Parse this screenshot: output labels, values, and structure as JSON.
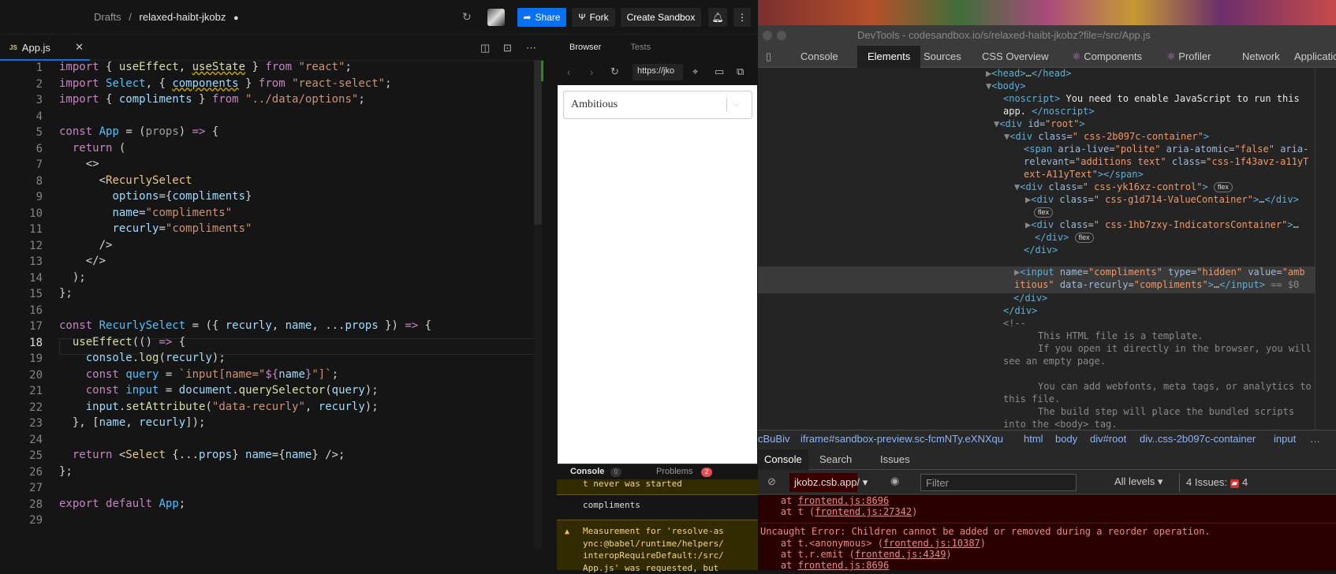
{
  "topbar": {
    "breadcrumb_root": "Drafts",
    "breadcrumb_sep": "/",
    "sandbox_name": "relaxed-haibt-jkobz",
    "share_label": "Share",
    "fork_label": "Fork",
    "create_label": "Create Sandbox"
  },
  "editor": {
    "tab_badge": "JS",
    "tab_label": "App.js",
    "active_line": "18",
    "line_numbers": [
      "1",
      "2",
      "3",
      "4",
      "5",
      "6",
      "7",
      "8",
      "9",
      "10",
      "11",
      "12",
      "13",
      "14",
      "15",
      "16",
      "17",
      "18",
      "19",
      "20",
      "21",
      "22",
      "23",
      "24",
      "25",
      "26",
      "27",
      "28",
      "29"
    ]
  },
  "preview": {
    "tab_browser": "Browser",
    "tab_tests": "Tests",
    "url": "https://jko",
    "select_value": "Ambitious",
    "console_tab": "Console",
    "console_count": "0",
    "problems_tab": "Problems",
    "problems_count": "2",
    "console_lines": {
      "l1": "t never was started",
      "l2": "compliments",
      "l3": "Measurement for 'resolve-as",
      "l4": "ync:@babel/runtime/helpers/",
      "l5": "interopRequireDefault:/src/",
      "l6": "App.js' was requested, but"
    }
  },
  "devtools": {
    "title": "DevTools - codesandbox.io/s/relaxed-haibt-jkobz?file=/src/App.js",
    "tabs": [
      "Console",
      "Elements",
      "Sources",
      "CSS Overview",
      "Components",
      "Profiler",
      "Network",
      "Applicatio"
    ],
    "breadcrumb": [
      "cBuBiv",
      "iframe#sandbox-preview.sc-fcmNTy.eXNXqu",
      "html",
      "body",
      "div#root",
      "div..css-2b097c-container",
      "input"
    ],
    "console_tabs": [
      "Console",
      "Search",
      "Issues"
    ],
    "context": "jkobz.csb.app/",
    "filter_placeholder": "Filter",
    "levels": "All levels",
    "issues": "4 Issues:",
    "issues_count": "4",
    "flex_badge": "flex",
    "log": {
      "l1a": "    at ",
      "l1b": "frontend.js:8696",
      "l2a": "    at t (",
      "l2b": "frontend.js:27342",
      "l2c": ")",
      "l3": "Uncaught Error: Children cannot be added or removed during a reorder operation.",
      "l4a": "    at t.<anonymous> (",
      "l4b": "frontend.js:10387",
      "l4c": ")",
      "l5a": "    at t.r.emit (",
      "l5b": "frontend.js:4349",
      "l5c": ")",
      "l6a": "    at ",
      "l6b": "frontend.js:8696"
    }
  },
  "colors": {
    "accent": "#0971f1",
    "error_bg": "#290000",
    "warning_bg": "#332b00"
  }
}
